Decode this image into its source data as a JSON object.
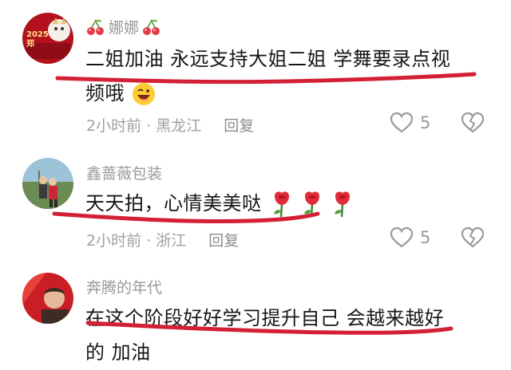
{
  "comments": [
    {
      "username": "娜娜",
      "avatar_badge": "2025 郑",
      "text_line1": "二姐加油 永远支持大姐二姐 学舞要录点视",
      "text_line2": "频哦",
      "meta": "2小时前 · 黑龙江",
      "reply_label": "回复",
      "like_count": "5"
    },
    {
      "username": "鑫蔷薇包装",
      "text_line1": "天天拍，心情美美哒",
      "meta": "2小时前 · 浙江",
      "reply_label": "回复",
      "like_count": "5"
    },
    {
      "username": "奔腾的年代",
      "text_line1": "在这个阶段好好学习提升自己 会越来越好",
      "text_line2": "的 加油"
    }
  ],
  "colors": {
    "underline": "#d42035",
    "meta": "#a0a0a0",
    "text": "#161616"
  },
  "icons": [
    "cherry-icon",
    "grinning-wink-emoji",
    "rose-emoji",
    "heart-outline-icon",
    "broken-heart-icon"
  ]
}
